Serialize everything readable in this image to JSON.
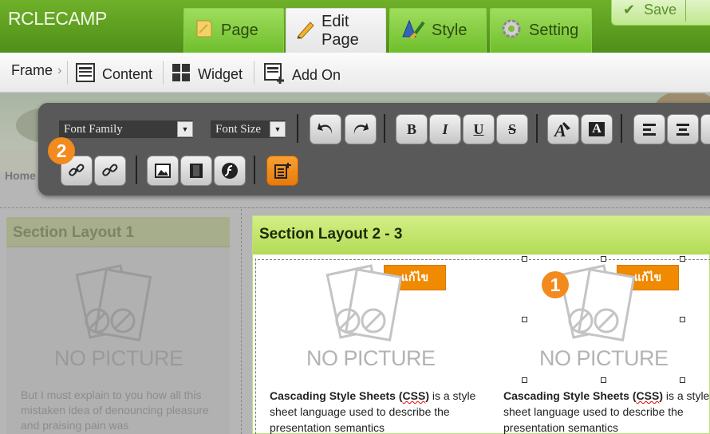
{
  "app": {
    "brand": "RCLECAMP"
  },
  "tabs": [
    {
      "label": "Page",
      "icon": "page-icon"
    },
    {
      "label": "Edit Page",
      "icon": "pencil-icon",
      "active": true
    },
    {
      "label": "Style",
      "icon": "brush-icon"
    },
    {
      "label": "Setting",
      "icon": "gear-icon"
    }
  ],
  "save": {
    "label": "Save"
  },
  "subnav": {
    "frame_label": "Frame",
    "items": [
      {
        "label": "Content",
        "icon": "content-icon"
      },
      {
        "label": "Widget",
        "icon": "widget-icon"
      },
      {
        "label": "Add On",
        "icon": "add-on-icon"
      }
    ]
  },
  "breadcrumb": {
    "home": "Home"
  },
  "toolbar": {
    "font_family": "Font Family",
    "font_size": "Font Size",
    "bold": "B",
    "italic": "I",
    "underline": "U",
    "strike": "S",
    "highlight": "A"
  },
  "badges": {
    "one": "1",
    "two": "2"
  },
  "section1": {
    "title": "Section Layout 1",
    "no_picture": "NO PICTURE",
    "text": "But I must explain to you how all this mistaken idea of denouncing pleasure and praising pain was"
  },
  "section2": {
    "title": "Section Layout 2 - 3",
    "edit_label": "แก้ไข",
    "no_picture": "NO PICTURE",
    "card_bold": "Cascading Style Sheets (",
    "card_css": "CSS",
    "card_close": ")",
    "card_rest": " is a style sheet language used to describe the presentation semantics"
  },
  "colors": {
    "accent_green": "#6fb02a",
    "orange": "#f08a00",
    "section_head": "#b3db56"
  }
}
